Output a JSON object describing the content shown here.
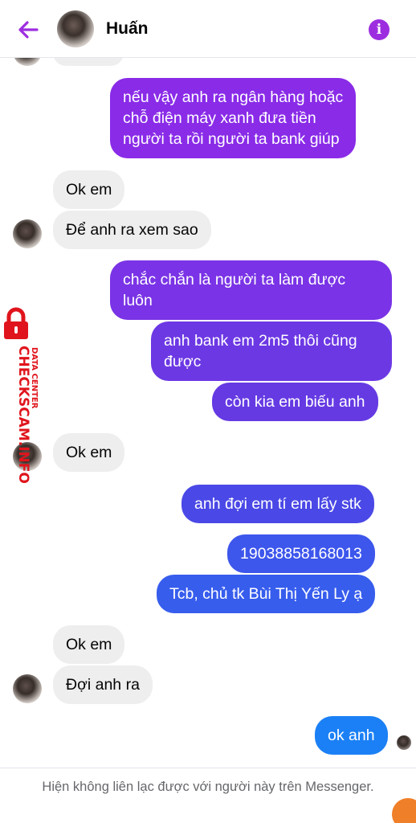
{
  "header": {
    "contact_name": "Huấn",
    "back_icon": "arrow-left-icon",
    "info_icon": "info-icon",
    "accent_color": "#9d2ee0"
  },
  "messages": [
    {
      "direction": "out",
      "text_lines": [
        "nếu vậy anh ra ngân hàng hoặc",
        "chỗ điện máy xanh đưa tiền",
        "người ta rồi người ta bank giúp"
      ],
      "color": "#8a2be8"
    },
    {
      "direction": "in",
      "text_lines": [
        "Ok em"
      ]
    },
    {
      "direction": "in",
      "text_lines": [
        "Để anh ra xem sao"
      ]
    },
    {
      "direction": "out",
      "text_lines": [
        "chắc chắn là người ta làm được",
        "luôn"
      ],
      "color": "#7a33e6"
    },
    {
      "direction": "out",
      "text_lines": [
        "anh bank em 2m5 thôi cũng",
        "được"
      ],
      "color": "#6c38e4"
    },
    {
      "direction": "out",
      "text_lines": [
        "còn kia em biếu anh"
      ],
      "color": "#653ae3"
    },
    {
      "direction": "in",
      "text_lines": [
        "Ok em"
      ]
    },
    {
      "direction": "out",
      "text_lines": [
        "anh đợi em tí em lấy stk"
      ],
      "color": "#4a48e6"
    },
    {
      "direction": "out",
      "text_lines": [
        "19038858168013"
      ],
      "color": "#3d56ec"
    },
    {
      "direction": "out",
      "text_lines": [
        "Tcb, chủ tk Bùi Thị Yến Ly ạ"
      ],
      "color": "#375ded"
    },
    {
      "direction": "in",
      "text_lines": [
        "Ok em"
      ]
    },
    {
      "direction": "in",
      "text_lines": [
        "Đợi anh ra"
      ]
    },
    {
      "direction": "out",
      "text_lines": [
        "ok anh"
      ],
      "color": "#1b80f5"
    }
  ],
  "watermark": {
    "line1": "CHECKSCAM.INFO",
    "line2": "DATA CENTER",
    "icon": "padlock-icon",
    "color": "#e0141c"
  },
  "footer": {
    "notice": "Hiện không liên lạc được với người này trên Messenger."
  }
}
